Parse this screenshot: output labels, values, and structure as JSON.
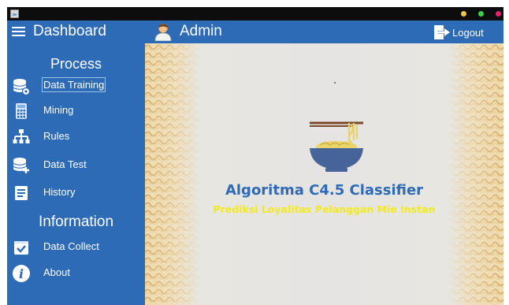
{
  "header": {
    "menu_icon": "hamburger-icon",
    "title": "Dashboard",
    "user_icon": "user-avatar-icon",
    "user_name": "Admin",
    "logout_icon": "logout-icon",
    "logout_label": "Logout"
  },
  "window": {
    "controls": [
      "minimize",
      "maximize",
      "close"
    ],
    "control_colors": [
      "#f3c44a",
      "#39d14b",
      "#e6226f"
    ]
  },
  "sidebar": {
    "process_heading": "Process",
    "information_heading": "Information",
    "process_items": [
      {
        "label": "Data Training",
        "icon": "database-gear-icon",
        "selected": true
      },
      {
        "label": "Mining",
        "icon": "calculator-icon"
      },
      {
        "label": "Rules",
        "icon": "hierarchy-icon"
      },
      {
        "label": "Data Test",
        "icon": "database-add-icon"
      },
      {
        "label": "History",
        "icon": "history-list-icon"
      }
    ],
    "information_items": [
      {
        "label": "Data Collect",
        "icon": "checkbox-icon"
      },
      {
        "label": "About",
        "icon": "info-icon"
      }
    ]
  },
  "main": {
    "logo_icon": "noodle-bowl-icon",
    "headline": "Algoritma C4.5 Classifier",
    "subline": "Prediksi Loyalitas Pelanggan Mie Instan"
  },
  "colors": {
    "primary": "#2e6bb7",
    "headline": "#2e6bb7",
    "subline": "#f2ea1c",
    "bowl": "#46649a"
  }
}
